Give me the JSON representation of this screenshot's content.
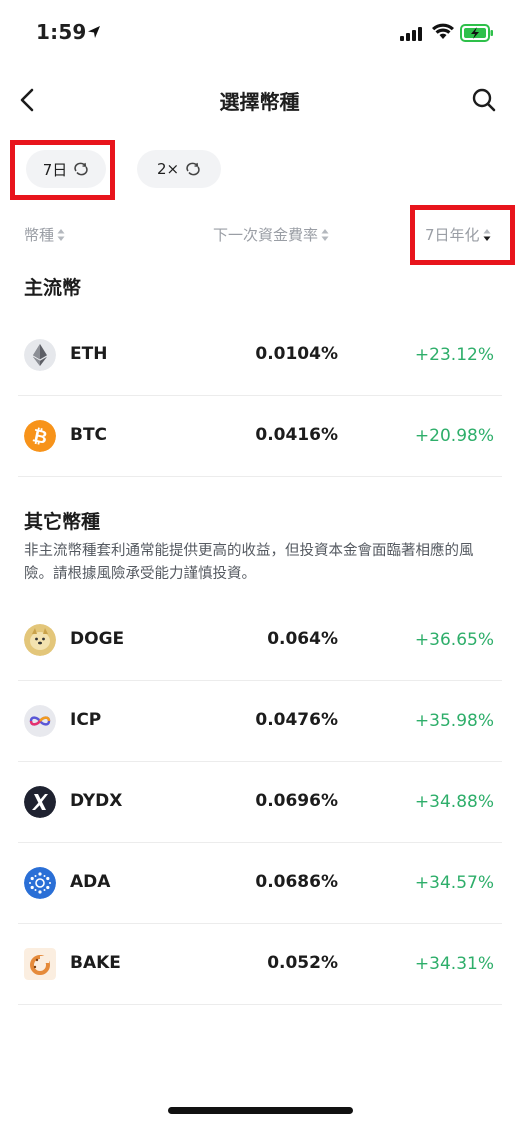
{
  "status_bar": {
    "time": "1:59"
  },
  "header": {
    "title": "選擇幣種"
  },
  "filters": {
    "period_label": "7日",
    "leverage_label": "2×"
  },
  "columns": {
    "coin": "幣種",
    "funding_rate": "下一次資金費率",
    "annualized": "7日年化"
  },
  "mainstream": {
    "title": "主流幣",
    "rows": [
      {
        "name": "ETH",
        "rate": "0.0104%",
        "annualized": "+23.12%",
        "icon": "eth-icon"
      },
      {
        "name": "BTC",
        "rate": "0.0416%",
        "annualized": "+20.98%",
        "icon": "btc-icon"
      }
    ]
  },
  "others": {
    "title": "其它幣種",
    "description": "非主流幣種套利通常能提供更高的收益，但投資本金會面臨著相應的風險。請根據風險承受能力謹慎投資。",
    "rows": [
      {
        "name": "DOGE",
        "rate": "0.064%",
        "annualized": "+36.65%",
        "icon": "doge-icon"
      },
      {
        "name": "ICP",
        "rate": "0.0476%",
        "annualized": "+35.98%",
        "icon": "icp-icon"
      },
      {
        "name": "DYDX",
        "rate": "0.0696%",
        "annualized": "+34.88%",
        "icon": "dydx-icon"
      },
      {
        "name": "ADA",
        "rate": "0.0686%",
        "annualized": "+34.57%",
        "icon": "ada-icon"
      },
      {
        "name": "BAKE",
        "rate": "0.052%",
        "annualized": "+34.31%",
        "icon": "bake-icon"
      }
    ]
  },
  "colors": {
    "positive": "#2eae6a",
    "highlight": "#e8141c",
    "chip_bg": "#f2f3f5"
  }
}
